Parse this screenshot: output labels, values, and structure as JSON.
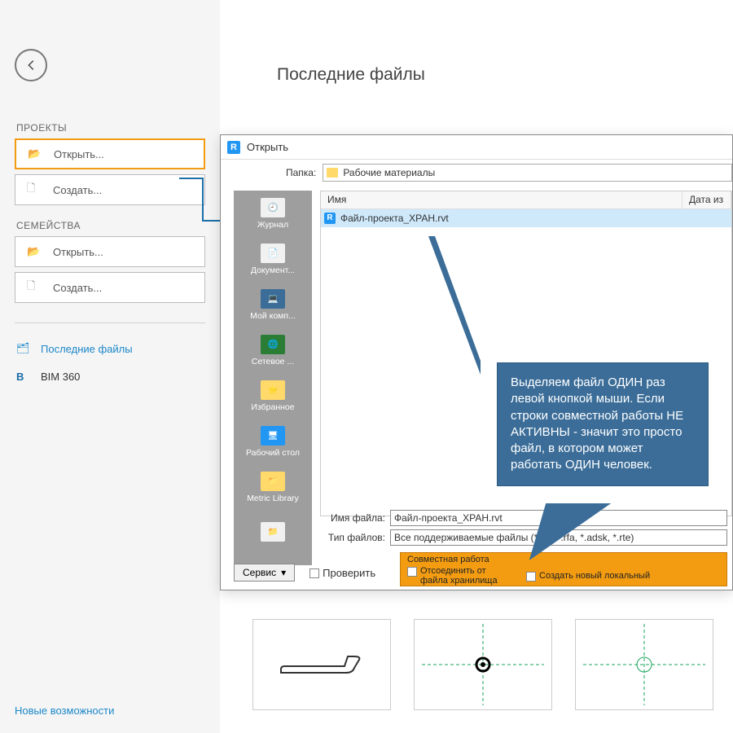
{
  "main_title": "Последние файлы",
  "sidebar": {
    "section_projects": "ПРОЕКТЫ",
    "section_families": "СЕМЕЙСТВА",
    "btn_open": "Открыть...",
    "btn_create": "Создать...",
    "nav_recent": "Последние файлы",
    "nav_bim360": "BIM 360",
    "link_new_features": "Новые возможности"
  },
  "dialog": {
    "title": "Открыть",
    "folder_label": "Папка:",
    "folder_value": "Рабочие материалы",
    "col_name": "Имя",
    "col_date": "Дата из",
    "file_name": "Файл-проекта_ХРАН.rvt",
    "filename_label": "Имя файла:",
    "filename_value": "Файл-проекта_ХРАН.rvt",
    "filetype_label": "Тип файлов:",
    "filetype_value": "Все поддерживаемые файлы (*.rvt, *.rfa, *.adsk, *.rte)",
    "wshare_title": "Совместная работа",
    "wshare_detach": "Отсоединить от файла хранилища",
    "wshare_newlocal": "Создать новый локальный",
    "btn_service": "Сервис",
    "chk_verify": "Проверить",
    "places": [
      "Журнал",
      "Документ...",
      "Мой комп...",
      "Сетевое ...",
      "Избранное",
      "Рабочий стол",
      "Metric Library",
      ""
    ]
  },
  "callout_text": "Выделяем файл ОДИН раз левой кнопкой мыши. Если строки совместной работы НЕ АКТИВНЫ - значит это просто файл, в котором может работать ОДИН человек."
}
